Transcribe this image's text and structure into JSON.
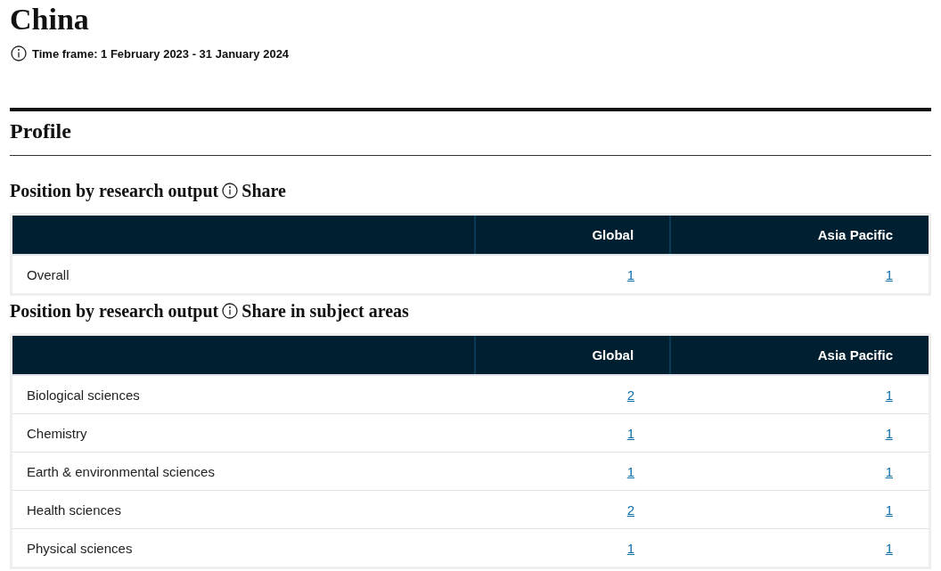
{
  "title": "China",
  "time_frame": "Time frame: 1 February 2023 - 31 January 2024",
  "section": "Profile",
  "tables": [
    {
      "heading_before": "Position by research output",
      "heading_after": "Share",
      "columns": [
        "",
        "Global",
        "Asia Pacific"
      ],
      "rows": [
        {
          "label": "Overall",
          "global": "1",
          "asia_pacific": "1"
        }
      ]
    },
    {
      "heading_before": "Position by research output",
      "heading_after": "Share in subject areas",
      "columns": [
        "",
        "Global",
        "Asia Pacific"
      ],
      "rows": [
        {
          "label": "Biological sciences",
          "global": "2",
          "asia_pacific": "1"
        },
        {
          "label": "Chemistry",
          "global": "1",
          "asia_pacific": "1"
        },
        {
          "label": "Earth & environmental sciences",
          "global": "1",
          "asia_pacific": "1"
        },
        {
          "label": "Health sciences",
          "global": "2",
          "asia_pacific": "1"
        },
        {
          "label": "Physical sciences",
          "global": "1",
          "asia_pacific": "1"
        }
      ]
    }
  ]
}
